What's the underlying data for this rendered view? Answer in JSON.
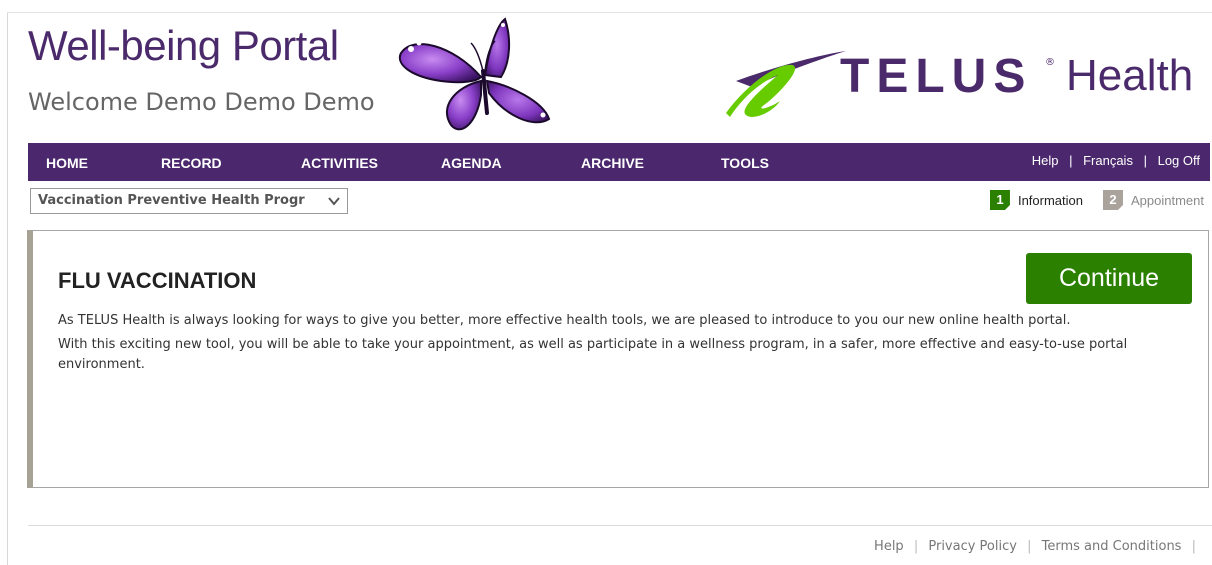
{
  "header": {
    "portal_title": "Well-being Portal",
    "welcome": "Welcome Demo Demo Demo",
    "brand_word": "TELUS",
    "brand_reg": "®",
    "brand_suffix": "Health"
  },
  "nav": {
    "items": [
      "HOME",
      "RECORD",
      "ACTIVITIES",
      "AGENDA",
      "ARCHIVE",
      "TOOLS"
    ],
    "help": "Help",
    "francais": "Français",
    "logoff": "Log Off",
    "separator": "|"
  },
  "program_select": {
    "selected": "Vaccination Preventive Health Progr"
  },
  "steps": [
    {
      "num": "1",
      "label": "Information",
      "active": true
    },
    {
      "num": "2",
      "label": "Appointment",
      "active": false
    }
  ],
  "content": {
    "title": "FLU VACCINATION",
    "continue_label": "Continue",
    "paragraph1": "As TELUS Health is always looking for ways to give you better, more effective health tools, we are pleased to introduce to you our new online health portal.",
    "paragraph2": "With this exciting new tool, you will be able to take your appointment, as well as participate in a wellness program, in a safer, more effective and easy-to-use portal environment."
  },
  "footer": {
    "help": "Help",
    "privacy": "Privacy Policy",
    "terms": "Terms and Conditions",
    "separator": "|"
  },
  "colors": {
    "brand_purple": "#4b286d",
    "action_green": "#2b8000",
    "step_inactive": "#a9a39b"
  },
  "icons": {
    "butterfly": "butterfly-logo",
    "swoosh": "telus-swoosh-logo",
    "dropdown": "chevron-down-icon"
  }
}
